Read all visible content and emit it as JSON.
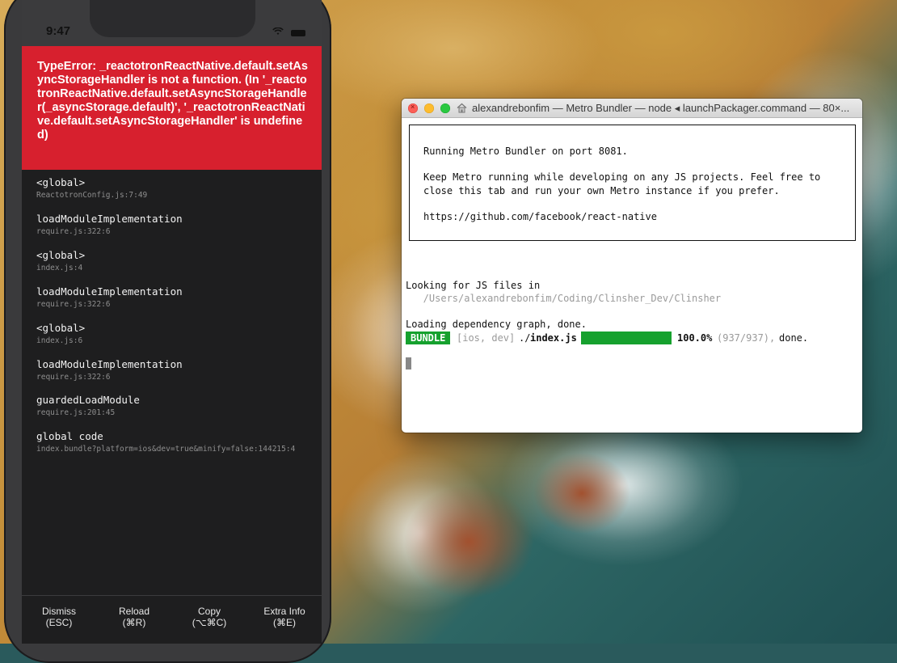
{
  "phone": {
    "status_time": "9:47",
    "error": {
      "message": "TypeError: _reactotronReactNative.default.setAsyncStorageHandler is not a function. (In '_reactotronReactNative.default.setAsyncStorageHandler(_asyncStorage.default)', '_reactotronReactNative.default.setAsyncStorageHandler' is undefined)"
    },
    "stack": [
      {
        "fn": "<global>",
        "loc": "ReactotronConfig.js:7:49"
      },
      {
        "fn": "loadModuleImplementation",
        "loc": "require.js:322:6"
      },
      {
        "fn": "<global>",
        "loc": "index.js:4"
      },
      {
        "fn": "loadModuleImplementation",
        "loc": "require.js:322:6"
      },
      {
        "fn": "<global>",
        "loc": "index.js:6"
      },
      {
        "fn": "loadModuleImplementation",
        "loc": "require.js:322:6"
      },
      {
        "fn": "guardedLoadModule",
        "loc": "require.js:201:45"
      },
      {
        "fn": "global code",
        "loc": "index.bundle?platform=ios&dev=true&minify=false:144215:4"
      }
    ],
    "footer": {
      "dismiss": {
        "label": "Dismiss",
        "shortcut": "(ESC)"
      },
      "reload": {
        "label": "Reload",
        "shortcut": "(⌘R)"
      },
      "copy": {
        "label": "Copy",
        "shortcut": "(⌥⌘C)"
      },
      "extra": {
        "label": "Extra Info",
        "shortcut": "(⌘E)"
      }
    }
  },
  "terminal": {
    "title": "alexandrebonfim — Metro Bundler — node ◂ launchPackager.command — 80×...",
    "box": {
      "line1": "Running Metro Bundler on port 8081.",
      "line2": "Keep Metro running while developing on any JS projects. Feel free to",
      "line3": "close this tab and run your own Metro instance if you prefer.",
      "line4": "https://github.com/facebook/react-native"
    },
    "looking": "Looking for JS files in",
    "path": "   /Users/alexandrebonfim/Coding/Clinsher_Dev/Clinsher",
    "loading": "Loading dependency graph, done.",
    "bundle": {
      "badge": "BUNDLE",
      "platform": "[ios, dev]",
      "file_prefix": "./",
      "file": "index.js",
      "percent": "100.0%",
      "count": "(937/937),",
      "done": "done.",
      "progress": 1.0
    }
  }
}
